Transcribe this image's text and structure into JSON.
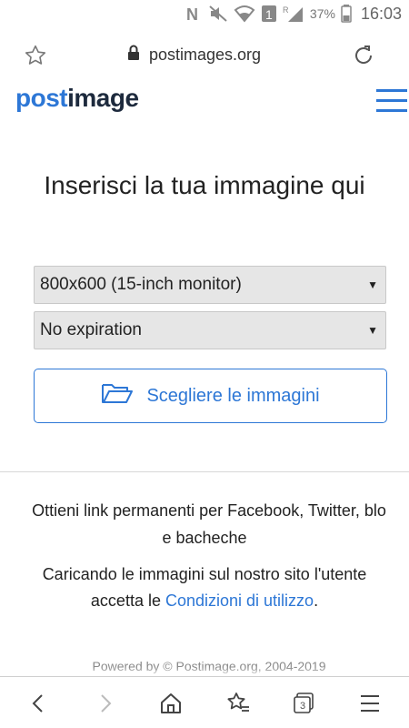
{
  "status_bar": {
    "battery_percent": "37%",
    "time": "16:03",
    "sim_label": "1",
    "roaming_label": "R"
  },
  "browser": {
    "url": "postimages.org",
    "open_tab_count": "3"
  },
  "header": {
    "logo_part1": "post",
    "logo_part2": "image"
  },
  "main": {
    "title": "Inserisci la tua immagine qui",
    "resize_select": {
      "selected": "800x600 (15-inch monitor)"
    },
    "expiration_select": {
      "selected": "No expiration"
    },
    "choose_button_label": "Scegliere le immagini"
  },
  "info": {
    "line1": "Ottieni link permanenti per Facebook, Twitter, blo",
    "line1b": "e bacheche",
    "line2_part1": "Caricando le immagini sul nostro sito l'utente",
    "line2_part2": "accetta le ",
    "terms_link": "Condizioni di utilizzo",
    "line2_end": "."
  },
  "footer": {
    "text": "Powered by © Postimage.org, 2004-2019"
  },
  "colors": {
    "accent": "#2d77d6",
    "logo_dark": "#1d2a3d"
  }
}
